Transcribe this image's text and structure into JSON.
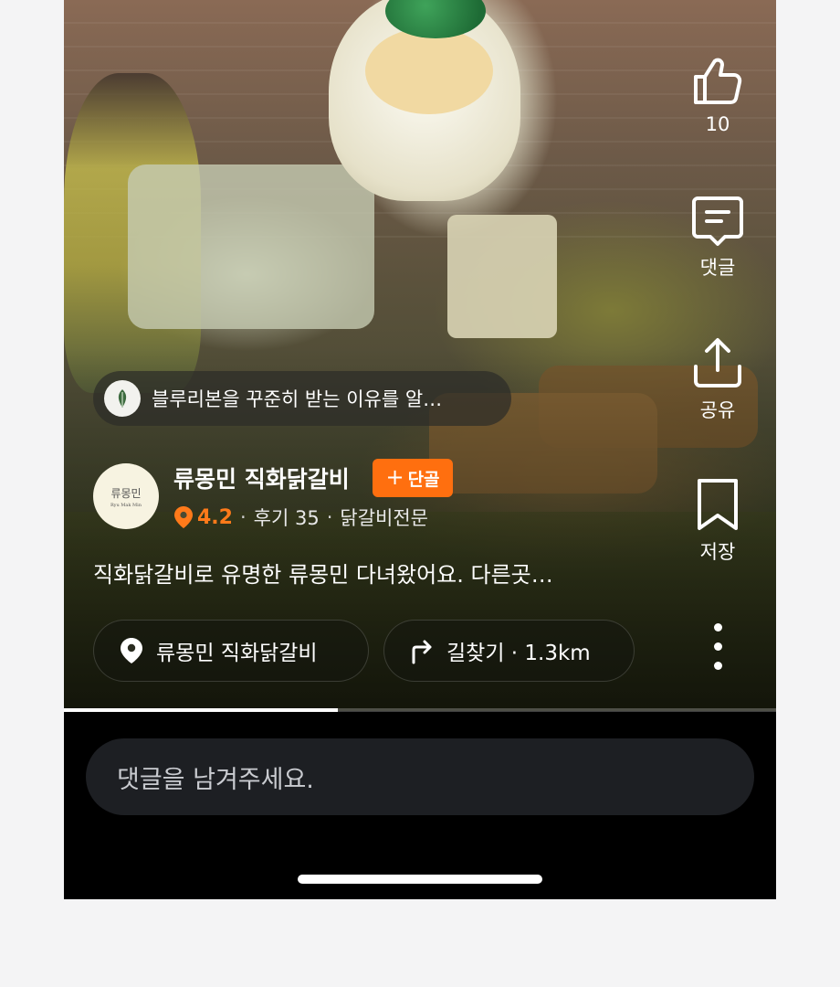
{
  "event_pill": {
    "text": "블루리본을 꾸준히 받는 이유를 알…"
  },
  "store": {
    "logo_text": "류몽민",
    "logo_subtext": "Ryu Mak Min",
    "name": "류몽민 직화닭갈비",
    "regular_button": {
      "plus": "+",
      "label": "단골"
    },
    "rating": "4.2",
    "reviews": "후기 35",
    "category": "닭갈비전문",
    "separator": "·"
  },
  "caption": "직화닭갈비로 유명한 류몽민 다녀왔어요. 다른곳…",
  "chips": {
    "place": "류몽민 직화닭갈비",
    "route": "길찾기 · 1.3km"
  },
  "actions": {
    "like_count": "10",
    "comment_label": "댓글",
    "share_label": "공유",
    "save_label": "저장"
  },
  "progress": {
    "fraction": 0.385
  },
  "comment_input": {
    "placeholder": "댓글을 남겨주세요."
  },
  "colors": {
    "accent": "#ff6f0f",
    "rating": "#ff7a1a",
    "input_bg": "#1d1f23"
  }
}
